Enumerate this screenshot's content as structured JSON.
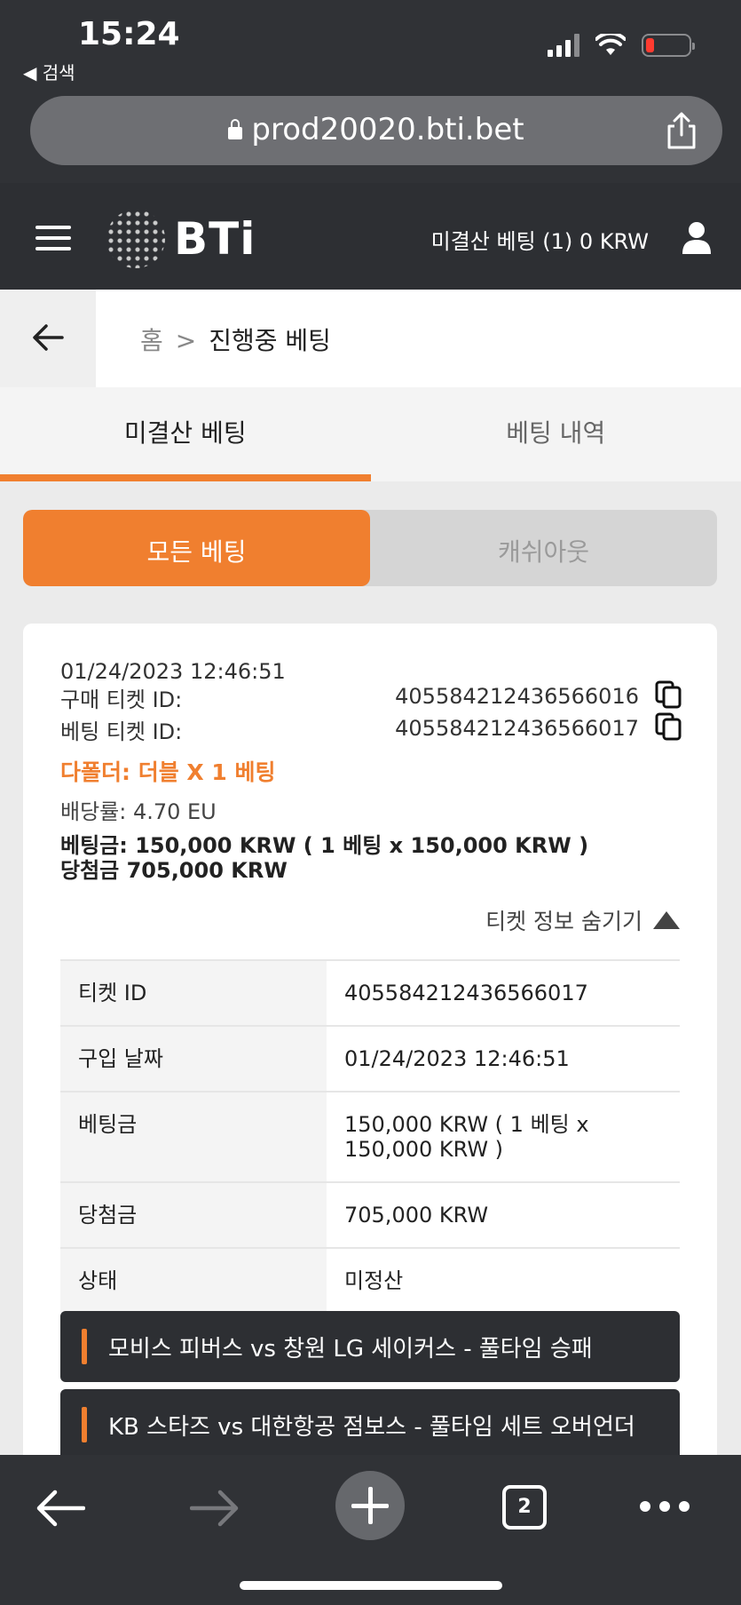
{
  "status_bar": {
    "time": "15:24",
    "back_label": "◀ 검색"
  },
  "address_bar": {
    "url": "prod20020.bti.bet"
  },
  "header": {
    "logo_text": "BTi",
    "open_bets_summary": "미결산 베팅 (1) 0 KRW"
  },
  "breadcrumb": {
    "home": "홈",
    "separator": ">",
    "current": "진행중 베팅"
  },
  "tabs": [
    {
      "label": "미결산 베팅",
      "active": true
    },
    {
      "label": "베팅 내역",
      "active": false
    }
  ],
  "filter": {
    "all_bets": "모든 베팅",
    "cashout": "캐쉬아웃"
  },
  "ticket": {
    "date": "01/24/2023 12:46:51",
    "purchase_id_label": "구매 티켓 ID:",
    "purchase_id": "405584212436566016",
    "bet_id_label": "베팅 티켓 ID:",
    "bet_id": "405584212436566017",
    "parlay": "다폴더: 더블 X 1 베팅",
    "odds": "배당률: 4.70 EU",
    "stake": "베팅금: 150,000 KRW ( 1 베팅 x 150,000 KRW )",
    "winnings": "당첨금 705,000 KRW",
    "hide_info": "티켓 정보 숨기기"
  },
  "details": [
    {
      "key": "티켓 ID",
      "value": "405584212436566017"
    },
    {
      "key": "구입 날짜",
      "value": "01/24/2023 12:46:51"
    },
    {
      "key": "베팅금",
      "value": "150,000 KRW ( 1 베팅 x 150,000 KRW )"
    },
    {
      "key": "당첨금",
      "value": "705,000 KRW"
    },
    {
      "key": "상태",
      "value": "미정산"
    }
  ],
  "events": [
    {
      "title": "모비스 피버스 vs 창원 LG 세이커스 - 풀타임 승패"
    },
    {
      "title": "KB 스타즈 vs 대한항공 점보스 - 풀타임 세트 오버언더"
    }
  ],
  "toolbar": {
    "tab_count": "2"
  },
  "colors": {
    "accent": "#f07f2f",
    "header_bg": "#2d2f33"
  }
}
